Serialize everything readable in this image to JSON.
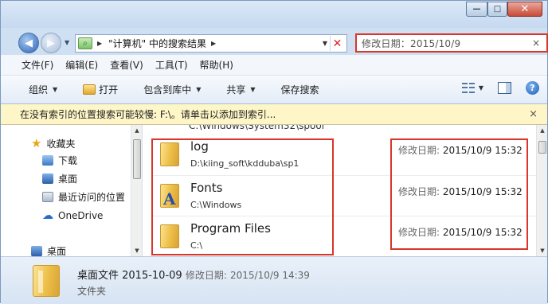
{
  "window": {
    "minimize_glyph": "—",
    "maximize_glyph": "□",
    "close_glyph": "✕"
  },
  "address": {
    "crumb": "\"计算机\" 中的搜索结果",
    "arrow": "▶",
    "drop": "▼",
    "close": "✕"
  },
  "search": {
    "value": "修改日期：2015/10/9",
    "clear": "×"
  },
  "menu": [
    "文件(F)",
    "编辑(E)",
    "查看(V)",
    "工具(T)",
    "帮助(H)"
  ],
  "toolbar": {
    "organize": "组织",
    "open": "打开",
    "include_in_library": "包含到库中",
    "share": "共享",
    "save_search": "保存搜索",
    "caret": "▼",
    "help": "?"
  },
  "infobar": {
    "text": "在没有索引的位置搜索可能较慢: F:\\。请单击以添加到索引...",
    "close": "×"
  },
  "nav": {
    "favorites": "收藏夹",
    "downloads": "下载",
    "desktop": "桌面",
    "recent": "最近访问的位置",
    "onedrive": "OneDrive",
    "desktop2": "桌面"
  },
  "content": {
    "cut_text": "C:\\Windows\\System32\\spool",
    "rows": [
      {
        "name": "log",
        "path": "D:\\kiing_soft\\kdduba\\sp1",
        "date_label": "修改日期:",
        "date": "2015/10/9 15:32"
      },
      {
        "name": "Fonts",
        "path": "C:\\Windows",
        "date_label": "修改日期:",
        "date": "2015/10/9 15:32"
      },
      {
        "name": "Program Files",
        "path": "C:\\",
        "date_label": "修改日期:",
        "date": "2015/10/9 15:32"
      }
    ]
  },
  "status": {
    "name": "桌面文件 2015-10-09",
    "date_label": "修改日期:",
    "date": "2015/10/9 14:39",
    "type": "文件夹"
  },
  "colors": {
    "highlight": "#d9352b",
    "infobar": "#fff6c8"
  }
}
